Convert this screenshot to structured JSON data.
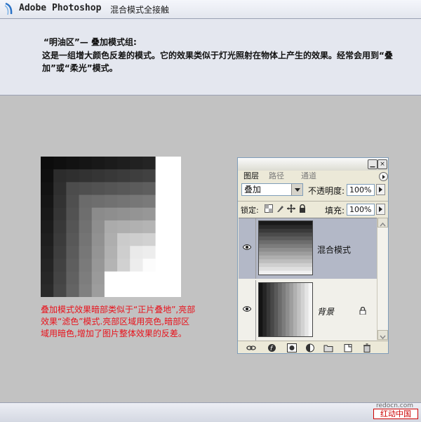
{
  "header": {
    "title": "Adobe Photoshop",
    "subtitle": "混合模式全接触"
  },
  "intro": {
    "heading": "“明油区”— 叠加模式组:",
    "body": "这是一组增大颜色反差的模式。它的效果类似于灯光照射在物体上产生的效果。经常会用到“叠加”或“柔光”模式。"
  },
  "caption": "叠加模式效果暗部类似于“正片叠地”,亮部效果“滤色”模式.亮部区域用亮色,暗部区域用暗色,增加了图片整体效果的反差。",
  "layers_panel": {
    "tabs": [
      "图层",
      "路径",
      "通道"
    ],
    "blend_mode": "叠加",
    "opacity_label": "不透明度:",
    "opacity_value": "100%",
    "lock_label": "锁定:",
    "fill_label": "填充:",
    "fill_value": "100%",
    "layers": [
      {
        "name": "混合模式",
        "selected": true
      },
      {
        "name": "背景",
        "locked": true
      }
    ],
    "bottom_icons": [
      "link-icon",
      "layer-style-icon",
      "layer-mask-icon",
      "adjustment-layer-icon",
      "new-group-icon",
      "new-layer-icon",
      "trash-icon"
    ]
  },
  "watermark": {
    "url": "redocn.com",
    "site": "红动中国"
  }
}
